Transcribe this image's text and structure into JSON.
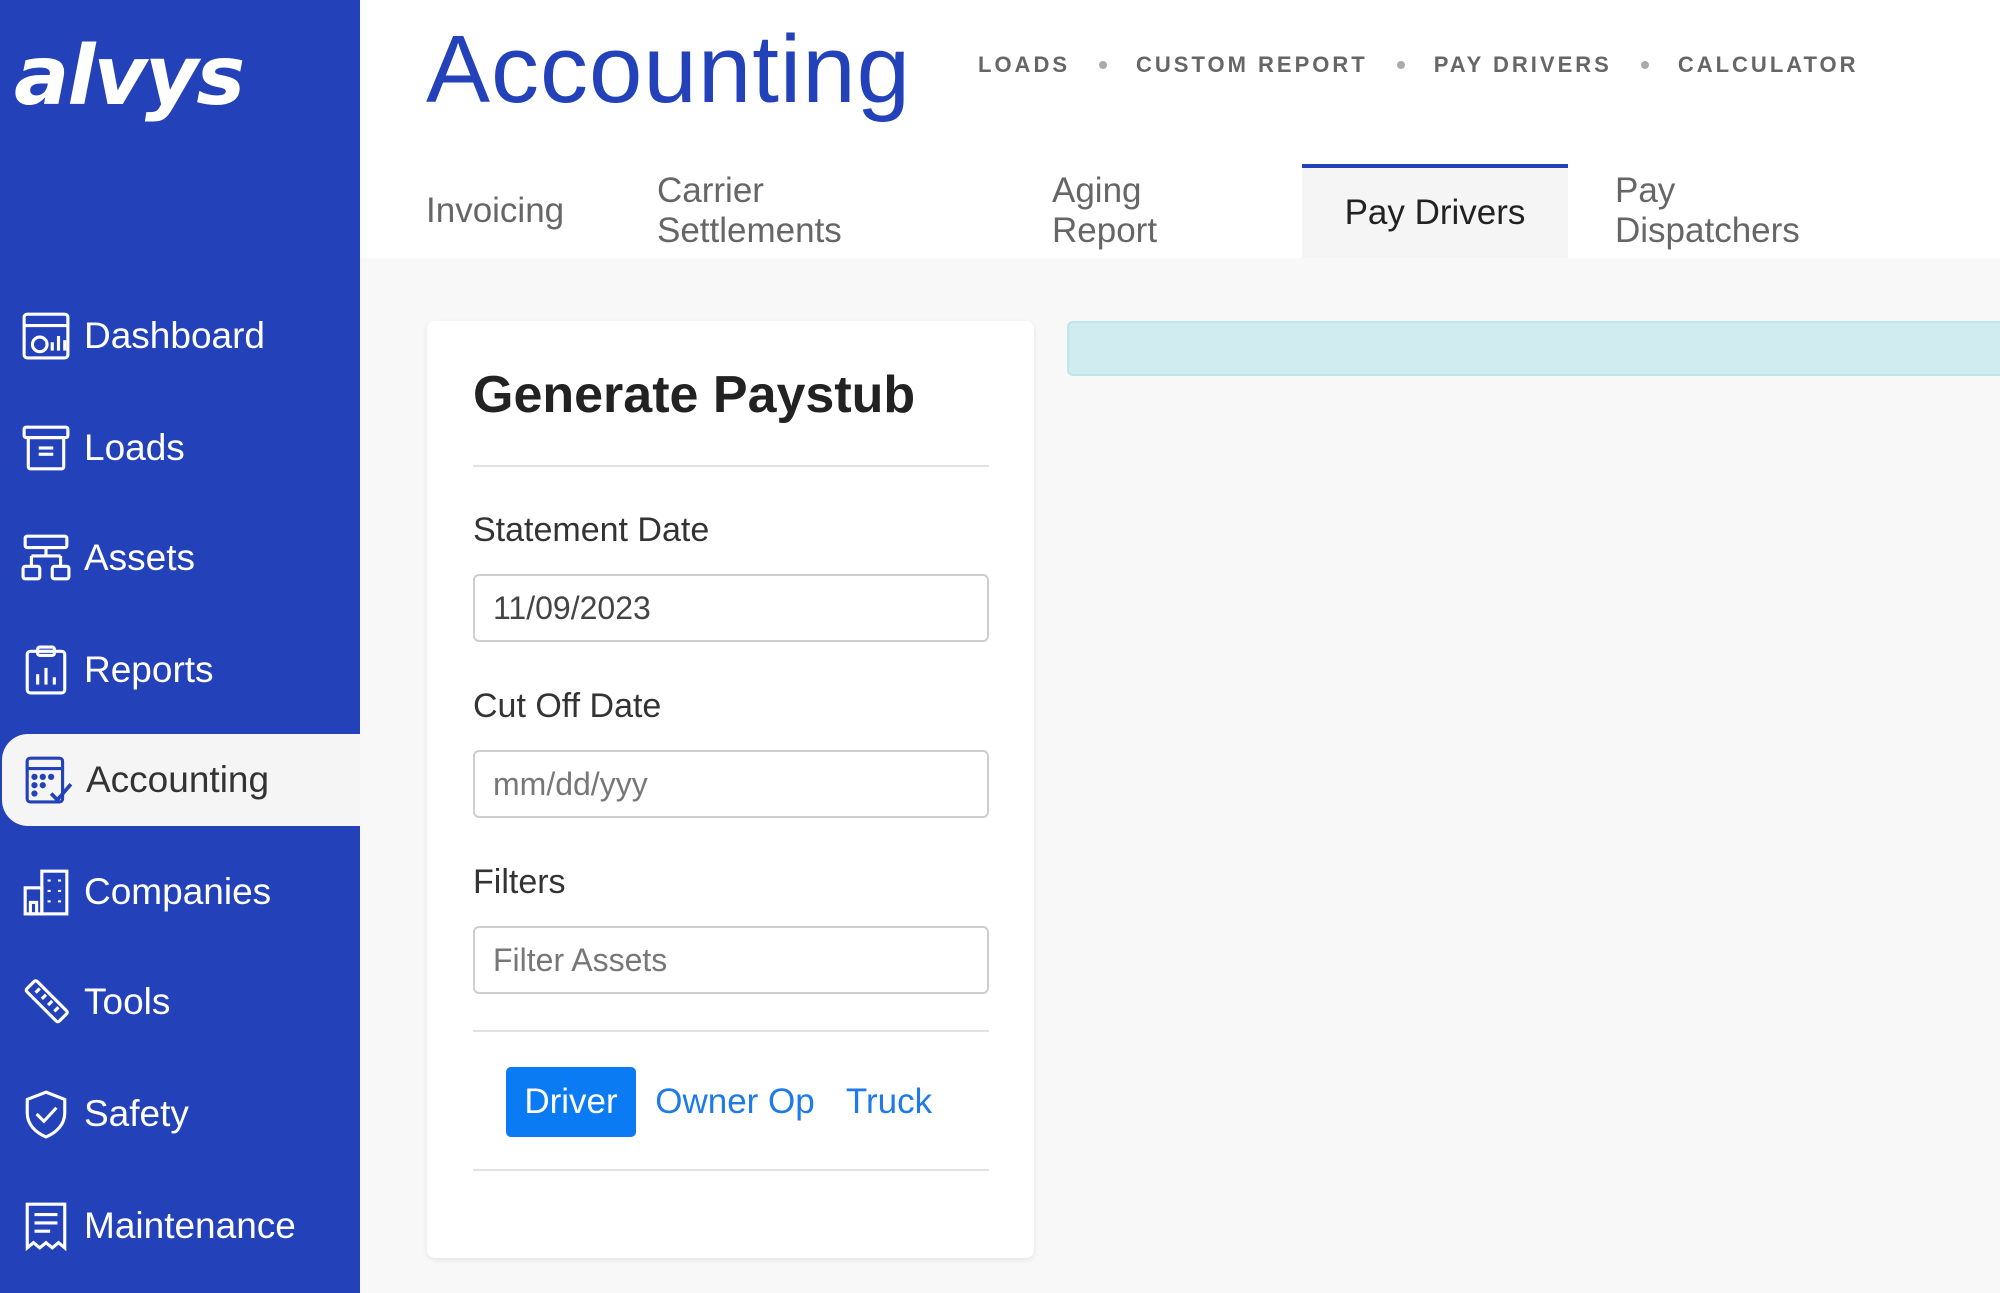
{
  "app": {
    "logo_text": "alvys"
  },
  "sidebar": {
    "items": [
      {
        "label": "Dashboard",
        "icon": "dashboard-icon"
      },
      {
        "label": "Loads",
        "icon": "archive-box-icon"
      },
      {
        "label": "Assets",
        "icon": "sitemap-icon"
      },
      {
        "label": "Reports",
        "icon": "clipboard-chart-icon"
      },
      {
        "label": "Accounting",
        "icon": "calculator-check-icon",
        "active": true
      },
      {
        "label": "Companies",
        "icon": "buildings-icon"
      },
      {
        "label": "Tools",
        "icon": "ruler-icon"
      },
      {
        "label": "Safety",
        "icon": "shield-check-icon"
      },
      {
        "label": "Maintenance",
        "icon": "receipt-icon"
      }
    ]
  },
  "header": {
    "title": "Accounting",
    "quick_links": [
      "LOADS",
      "CUSTOM REPORT",
      "PAY DRIVERS",
      "CALCULATOR"
    ],
    "tabs": [
      {
        "label": "Invoicing"
      },
      {
        "label": "Carrier Settlements"
      },
      {
        "label": "Aging Report"
      },
      {
        "label": "Pay Drivers",
        "active": true
      },
      {
        "label": "Pay Dispatchers"
      }
    ]
  },
  "card": {
    "title": "Generate Paystub",
    "statement_date": {
      "label": "Statement Date",
      "value": "11/09/2023"
    },
    "cutoff_date": {
      "label": "Cut Off Date",
      "placeholder": "mm/dd/yyy"
    },
    "filters": {
      "label": "Filters",
      "placeholder": "Filter Assets"
    },
    "types": [
      {
        "label": "Driver",
        "active": true
      },
      {
        "label": "Owner Op"
      },
      {
        "label": "Truck"
      }
    ]
  },
  "colors": {
    "brand": "#2341b8",
    "primary_button": "#0a7bf2",
    "link": "#1e7ae8",
    "info_bar": "#d1ecf1"
  }
}
